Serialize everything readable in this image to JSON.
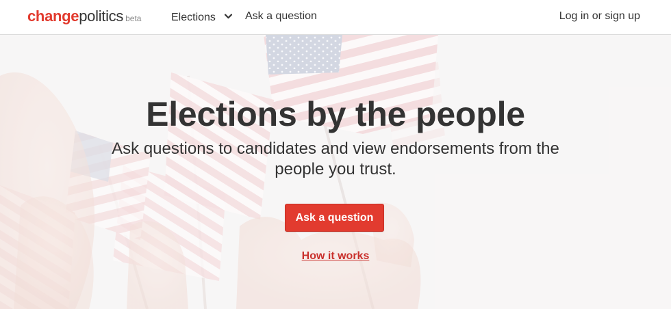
{
  "brand": {
    "name_primary": "change",
    "name_secondary": "politics",
    "tag": "beta",
    "accent_color": "#e23b2f"
  },
  "nav": {
    "elections_label": "Elections",
    "elections_icon": "chevron-down-icon",
    "ask_label": "Ask a question",
    "login_label": "Log in or sign up"
  },
  "hero": {
    "title": "Elections by the people",
    "subtitle": "Ask questions to candidates and view endorsements from the people you trust.",
    "cta_label": "Ask a question",
    "secondary_link": "How it works",
    "background": "faded photo of hands waving american flags"
  },
  "colors": {
    "link_red": "#c9302c",
    "text_dark": "#333333"
  }
}
